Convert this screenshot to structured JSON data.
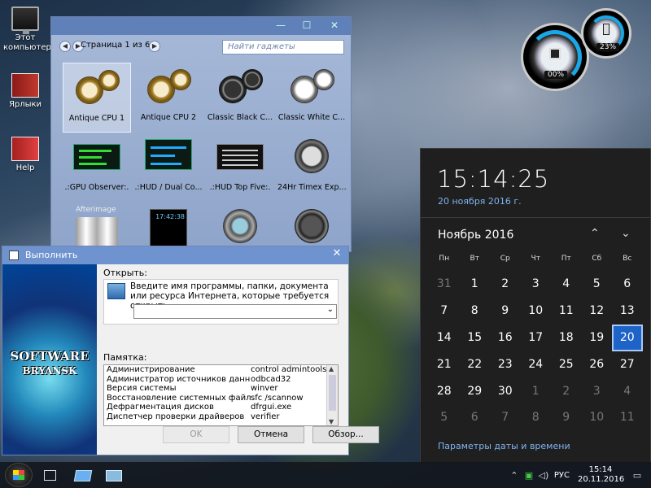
{
  "desktop": {
    "icons": [
      {
        "label": "Этот компьютер"
      },
      {
        "label": "Ярлыки"
      },
      {
        "label": "Help"
      }
    ]
  },
  "gallery": {
    "controls": {
      "minimize": "—",
      "maximize": "☐",
      "close": "✕"
    },
    "page_label": "Страница 1 из 6",
    "search_placeholder": "Найти гаджеты",
    "tiles": [
      {
        "label": "Antique CPU 1",
        "selected": true
      },
      {
        "label": "Antique CPU 2"
      },
      {
        "label": "Classic Black C..."
      },
      {
        "label": "Classic White C..."
      },
      {
        "label": ".:GPU Observer:."
      },
      {
        "label": ".:HUD / Dual Co..."
      },
      {
        "label": ".:HUD Top Five:."
      },
      {
        "label": "24Hr Timex Exp..."
      },
      {
        "label": "Afterimage"
      },
      {
        "label": "17:42:38"
      },
      {
        "label": ""
      },
      {
        "label": ""
      }
    ]
  },
  "run": {
    "title": "Выполнить",
    "close": "✕",
    "banner_line1": "SOFTWARE",
    "banner_line2": "BRYANSK",
    "open_label": "Открыть:",
    "description": "Введите имя программы, папки, документа или ресурса Интернета, которые требуется открыть.",
    "combo_value": "",
    "memo_label": "Памятка:",
    "memo_rows": [
      {
        "name": "Администрирование",
        "cmd": "control admintools"
      },
      {
        "name": "Администратор источников данных",
        "cmd": "odbcad32"
      },
      {
        "name": "Версия системы",
        "cmd": "winver"
      },
      {
        "name": "Восстановление системных файлов",
        "cmd": "sfc /scannow"
      },
      {
        "name": "Дефрагментация дисков",
        "cmd": "dfrgui.exe"
      },
      {
        "name": "Диспетчер проверки драйверов",
        "cmd": "verifier"
      }
    ],
    "buttons": {
      "ok": "OK",
      "cancel": "Отмена",
      "browse": "Обзор..."
    }
  },
  "meters": {
    "cpu": "00%",
    "memory": "23%"
  },
  "flyout": {
    "time": "15:14:25",
    "date": "20 ноября 2016 г.",
    "month": "Ноябрь 2016",
    "weekdays": [
      "Пн",
      "Вт",
      "Ср",
      "Чт",
      "Пт",
      "Сб",
      "Вс"
    ],
    "days": [
      "31",
      "1",
      "2",
      "3",
      "4",
      "5",
      "6",
      "7",
      "8",
      "9",
      "10",
      "11",
      "12",
      "13",
      "14",
      "15",
      "16",
      "17",
      "18",
      "19",
      "20",
      "21",
      "22",
      "23",
      "24",
      "25",
      "26",
      "27",
      "28",
      "29",
      "30",
      "1",
      "2",
      "3",
      "4",
      "5",
      "6",
      "7",
      "8",
      "9",
      "10",
      "11"
    ],
    "settings_link": "Параметры даты и времени"
  },
  "taskbar": {
    "lang": "РУС",
    "time": "15:14",
    "date": "20.11.2016"
  }
}
